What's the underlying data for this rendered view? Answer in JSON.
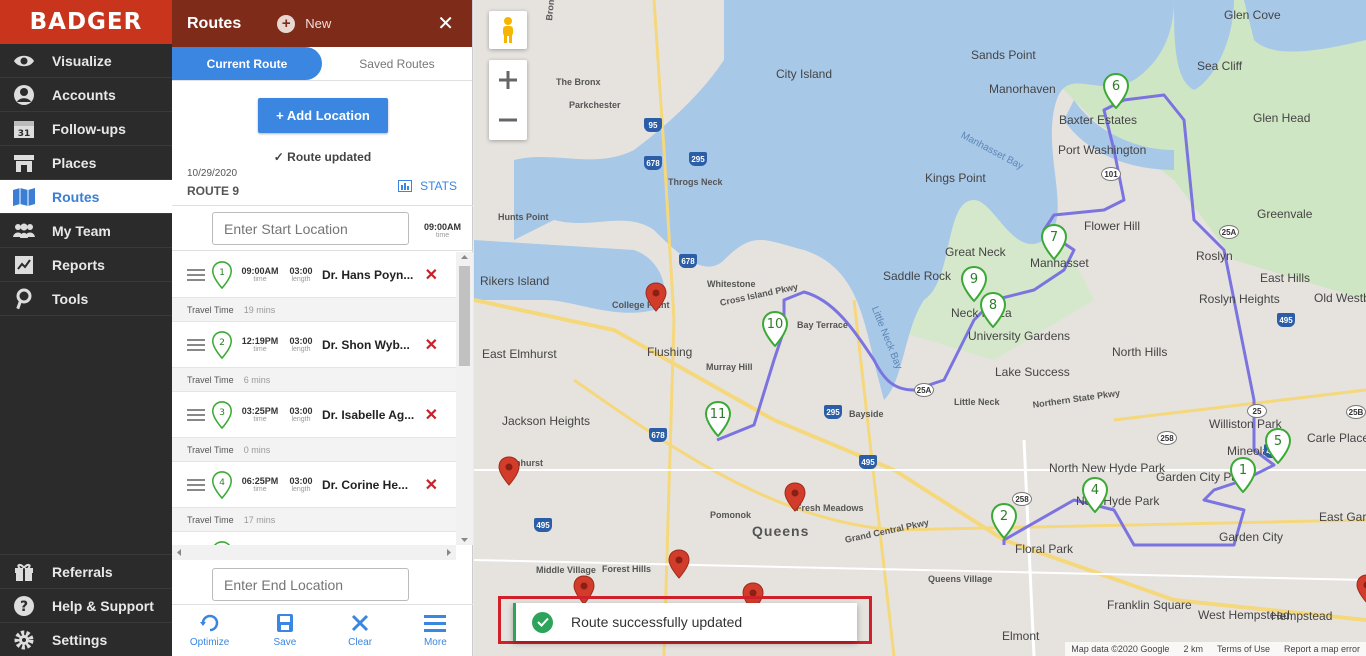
{
  "brand": {
    "logo_text": "BADGER",
    "color": "#c9351c"
  },
  "nav": {
    "items": [
      {
        "label": "Visualize",
        "icon": "eye-icon"
      },
      {
        "label": "Accounts",
        "icon": "person-icon"
      },
      {
        "label": "Follow-ups",
        "icon": "calendar-icon",
        "badge": "31"
      },
      {
        "label": "Places",
        "icon": "store-icon"
      },
      {
        "label": "Routes",
        "icon": "map-icon",
        "active": true
      },
      {
        "label": "My Team",
        "icon": "team-icon"
      },
      {
        "label": "Reports",
        "icon": "report-icon"
      },
      {
        "label": "Tools",
        "icon": "tools-icon"
      }
    ],
    "bottom_items": [
      {
        "label": "Referrals",
        "icon": "gift-icon"
      },
      {
        "label": "Help & Support",
        "icon": "help-icon"
      },
      {
        "label": "Settings",
        "icon": "gear-icon"
      }
    ]
  },
  "panel": {
    "title": "Routes",
    "new_label": "New",
    "close_label": "✕",
    "tabs": [
      {
        "label": "Current Route",
        "active": true
      },
      {
        "label": "Saved Routes",
        "active": false
      }
    ],
    "add_location_label": "+ Add Location",
    "status_text": "✓  Route updated",
    "date": "10/29/2020",
    "route_name": "ROUTE 9",
    "stats_label": "STATS",
    "start_placeholder": "Enter Start Location",
    "start_time": "09:00AM",
    "start_time_sub": "time",
    "end_placeholder": "Enter End Location",
    "stops": [
      {
        "num": "1",
        "time": "09:00AM",
        "time_sub": "time",
        "length": "03:00",
        "length_sub": "length",
        "name": "Dr. Hans Poyn...",
        "travel_label": "Travel Time",
        "travel": "19 mins"
      },
      {
        "num": "2",
        "time": "12:19PM",
        "time_sub": "time",
        "length": "03:00",
        "length_sub": "length",
        "name": "Dr. Shon Wyb...",
        "travel_label": "Travel Time",
        "travel": "6 mins"
      },
      {
        "num": "3",
        "time": "03:25PM",
        "time_sub": "time",
        "length": "03:00",
        "length_sub": "length",
        "name": "Dr. Isabelle Ag...",
        "travel_label": "Travel Time",
        "travel": "0 mins"
      },
      {
        "num": "4",
        "time": "06:25PM",
        "time_sub": "time",
        "length": "03:00",
        "length_sub": "length",
        "name": "Dr. Corine He...",
        "travel_label": "Travel Time",
        "travel": "17 mins"
      }
    ],
    "toolbar": [
      {
        "label": "Optimize",
        "icon": "optimize-icon"
      },
      {
        "label": "Save",
        "icon": "save-icon"
      },
      {
        "label": "Clear",
        "icon": "clear-icon"
      },
      {
        "label": "More",
        "icon": "menu-icon"
      }
    ]
  },
  "map": {
    "labels": [
      "Glen Cove",
      "Sands Point",
      "City Island",
      "Sea Cliff",
      "Manorhaven",
      "Baxter Estates",
      "Glen Head",
      "Port Washington",
      "Kings Point",
      "Flower Hill",
      "Greenvale",
      "Great Neck",
      "Manhasset",
      "Saddle Rock",
      "Roslyn",
      "East Hills",
      "Neck Plaza",
      "University Gardens",
      "Roslyn Heights",
      "Old Westbury",
      "North Hills",
      "Lake Success",
      "Rikers Island",
      "College Point",
      "Whitestone",
      "Bay Terrace",
      "Flushing",
      "Murray Hill",
      "Bayside",
      "Little Neck",
      "East Elmhurst",
      "Jackson Heights",
      "Elmhurst",
      "Pomonok",
      "Fresh Meadows",
      "Williston Park",
      "Carle Place",
      "Mineola",
      "North New Hyde Park",
      "Garden City Park",
      "New Hyde Park",
      "Floral Park",
      "Garden City",
      "East Garden City",
      "Queens",
      "Middle Village",
      "Forest Hills",
      "Queens Village",
      "Franklin Square",
      "West Hempstead",
      "Hempstead",
      "Elmont",
      "The Bronx",
      "Parkchester",
      "Throgs Neck",
      "Hunts Point",
      "Manhasset Bay",
      "Little Neck Bay",
      "Bronx River Pkwy",
      "Cross Island Pkwy",
      "Grand Central Pkwy",
      "Northern State Pkwy"
    ],
    "shields": [
      "95",
      "678",
      "295",
      "678",
      "25A",
      "295",
      "495",
      "678",
      "495",
      "495",
      "25A",
      "495",
      "25B",
      "258",
      "258",
      "25",
      "101"
    ],
    "route_pins": [
      "1",
      "2",
      "4",
      "5",
      "6",
      "7",
      "8",
      "9",
      "10",
      "11"
    ],
    "route_color": "#7b74e0",
    "attribution": [
      "Map data ©2020 Google",
      "2 km",
      "Terms of Use",
      "Report a map error"
    ]
  },
  "toast": {
    "message": "Route successfully updated",
    "color": "#2ea35c"
  }
}
